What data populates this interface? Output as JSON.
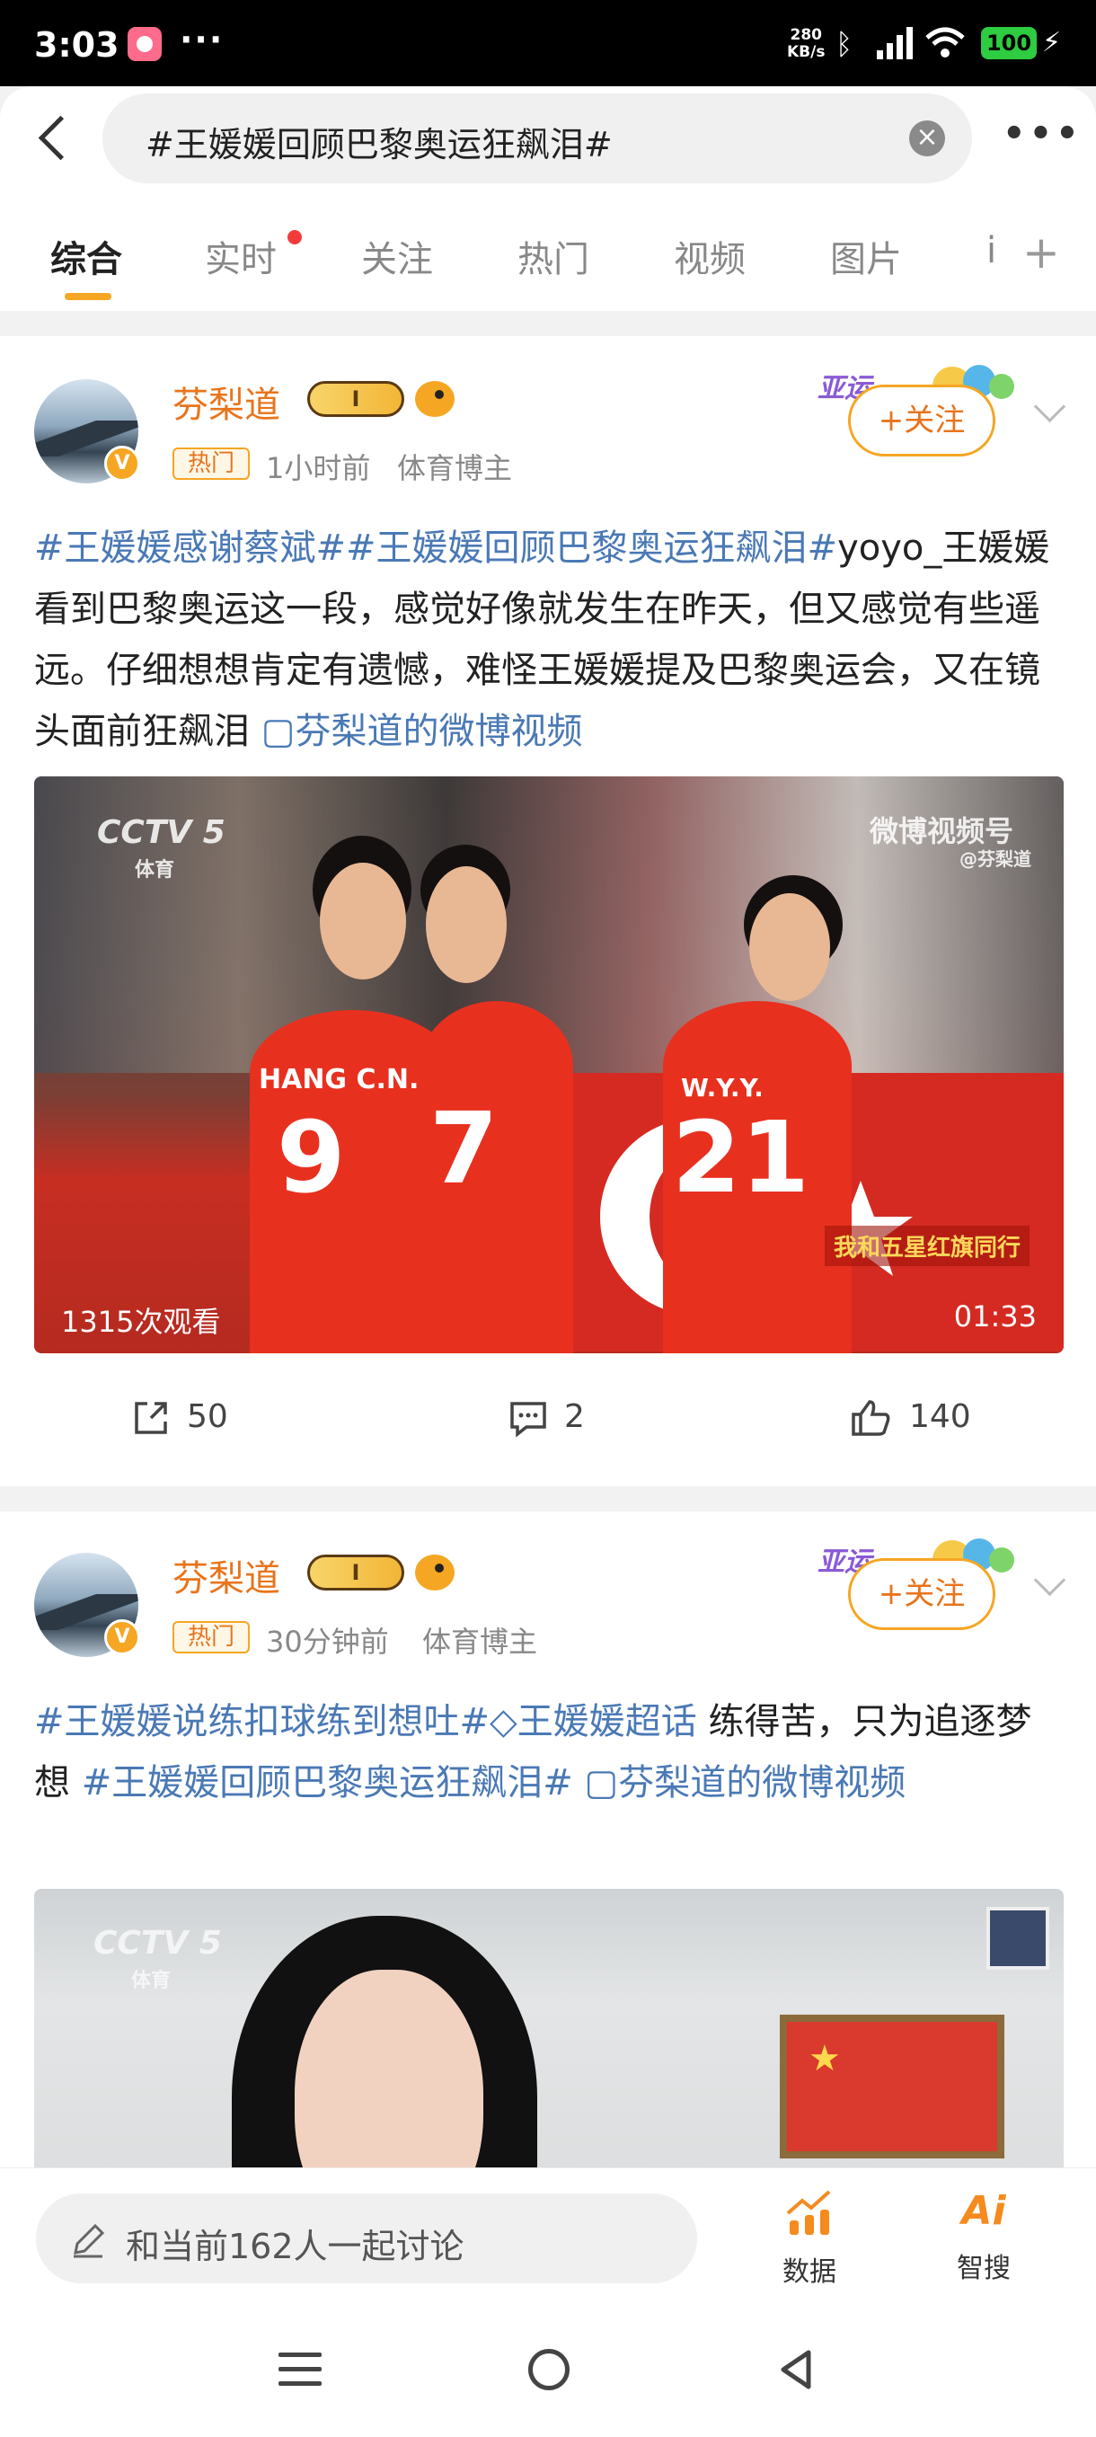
{
  "status_bar": {
    "time": "3:03",
    "more": "···",
    "net_speed_line1": "280",
    "net_speed_line2": "KB/s",
    "battery": "100"
  },
  "search": {
    "query": "#王媛媛回顾巴黎奥运狂飙泪#",
    "more": "•••"
  },
  "tabs": [
    {
      "label": "综合",
      "active": true
    },
    {
      "label": "实时",
      "dot": true
    },
    {
      "label": "关注"
    },
    {
      "label": "热门"
    },
    {
      "label": "视频"
    },
    {
      "label": "图片"
    },
    {
      "label": "i"
    }
  ],
  "posts": [
    {
      "username": "芬梨道",
      "level_badge": "I",
      "hot_label": "热门",
      "time": "1小时前",
      "category": "体育博主",
      "follow_label": "+关注",
      "verified_badge": "V",
      "text_parts": [
        {
          "text": "#王媛媛感谢蔡斌##王媛媛回顾巴黎奥运狂飙泪#",
          "tag": true
        },
        {
          "text": "yoyo_王媛媛 看到巴黎奥运这一段，感觉好像就发生在昨天，但又感觉有些遥远。仔细想想肯定有遗憾，难怪王媛媛提及巴黎奥运会，又在镜头面前狂飙泪 ",
          "tag": false
        },
        {
          "text": "▢芬梨道的微博视频",
          "tag": true
        }
      ],
      "video": {
        "channel_logo": "CCTV 5",
        "channel_sub": "体育",
        "watermark": "微博视频号",
        "watermark_sub": "@芬梨道",
        "slogan": "我和五星红旗同行",
        "jersey_names": [
          "HANG C.N.",
          "W.Y.Y."
        ],
        "jersey_numbers": [
          "9",
          "7",
          "21"
        ],
        "views": "1315次观看",
        "duration": "01:33"
      },
      "actions": {
        "share": "50",
        "comment": "2",
        "like": "140"
      }
    },
    {
      "username": "芬梨道",
      "level_badge": "I",
      "hot_label": "热门",
      "time": "30分钟前",
      "category": "体育博主",
      "follow_label": "+关注",
      "verified_badge": "V",
      "text_parts": [
        {
          "text": "#王媛媛说练扣球练到想吐#",
          "tag": true
        },
        {
          "text": "◇王媛媛超话",
          "tag": true
        },
        {
          "text": " 练得苦，只为追逐梦想 ",
          "tag": false
        },
        {
          "text": "#王媛媛回顾巴黎奥运狂飙泪#",
          "tag": true
        },
        {
          "text": " ▢芬梨道的微博视频",
          "tag": true
        }
      ],
      "video": {
        "channel_logo": "CCTV 5",
        "channel_sub": "体育"
      }
    }
  ],
  "bottom_bar": {
    "discuss_placeholder": "和当前162人一起讨论",
    "data_label": "数据",
    "ai_label": "智搜",
    "ai_icon_text": "Ai"
  },
  "colors": {
    "accent": "#f5a623",
    "username": "#e8741c",
    "topic_link": "#4a79b5"
  }
}
